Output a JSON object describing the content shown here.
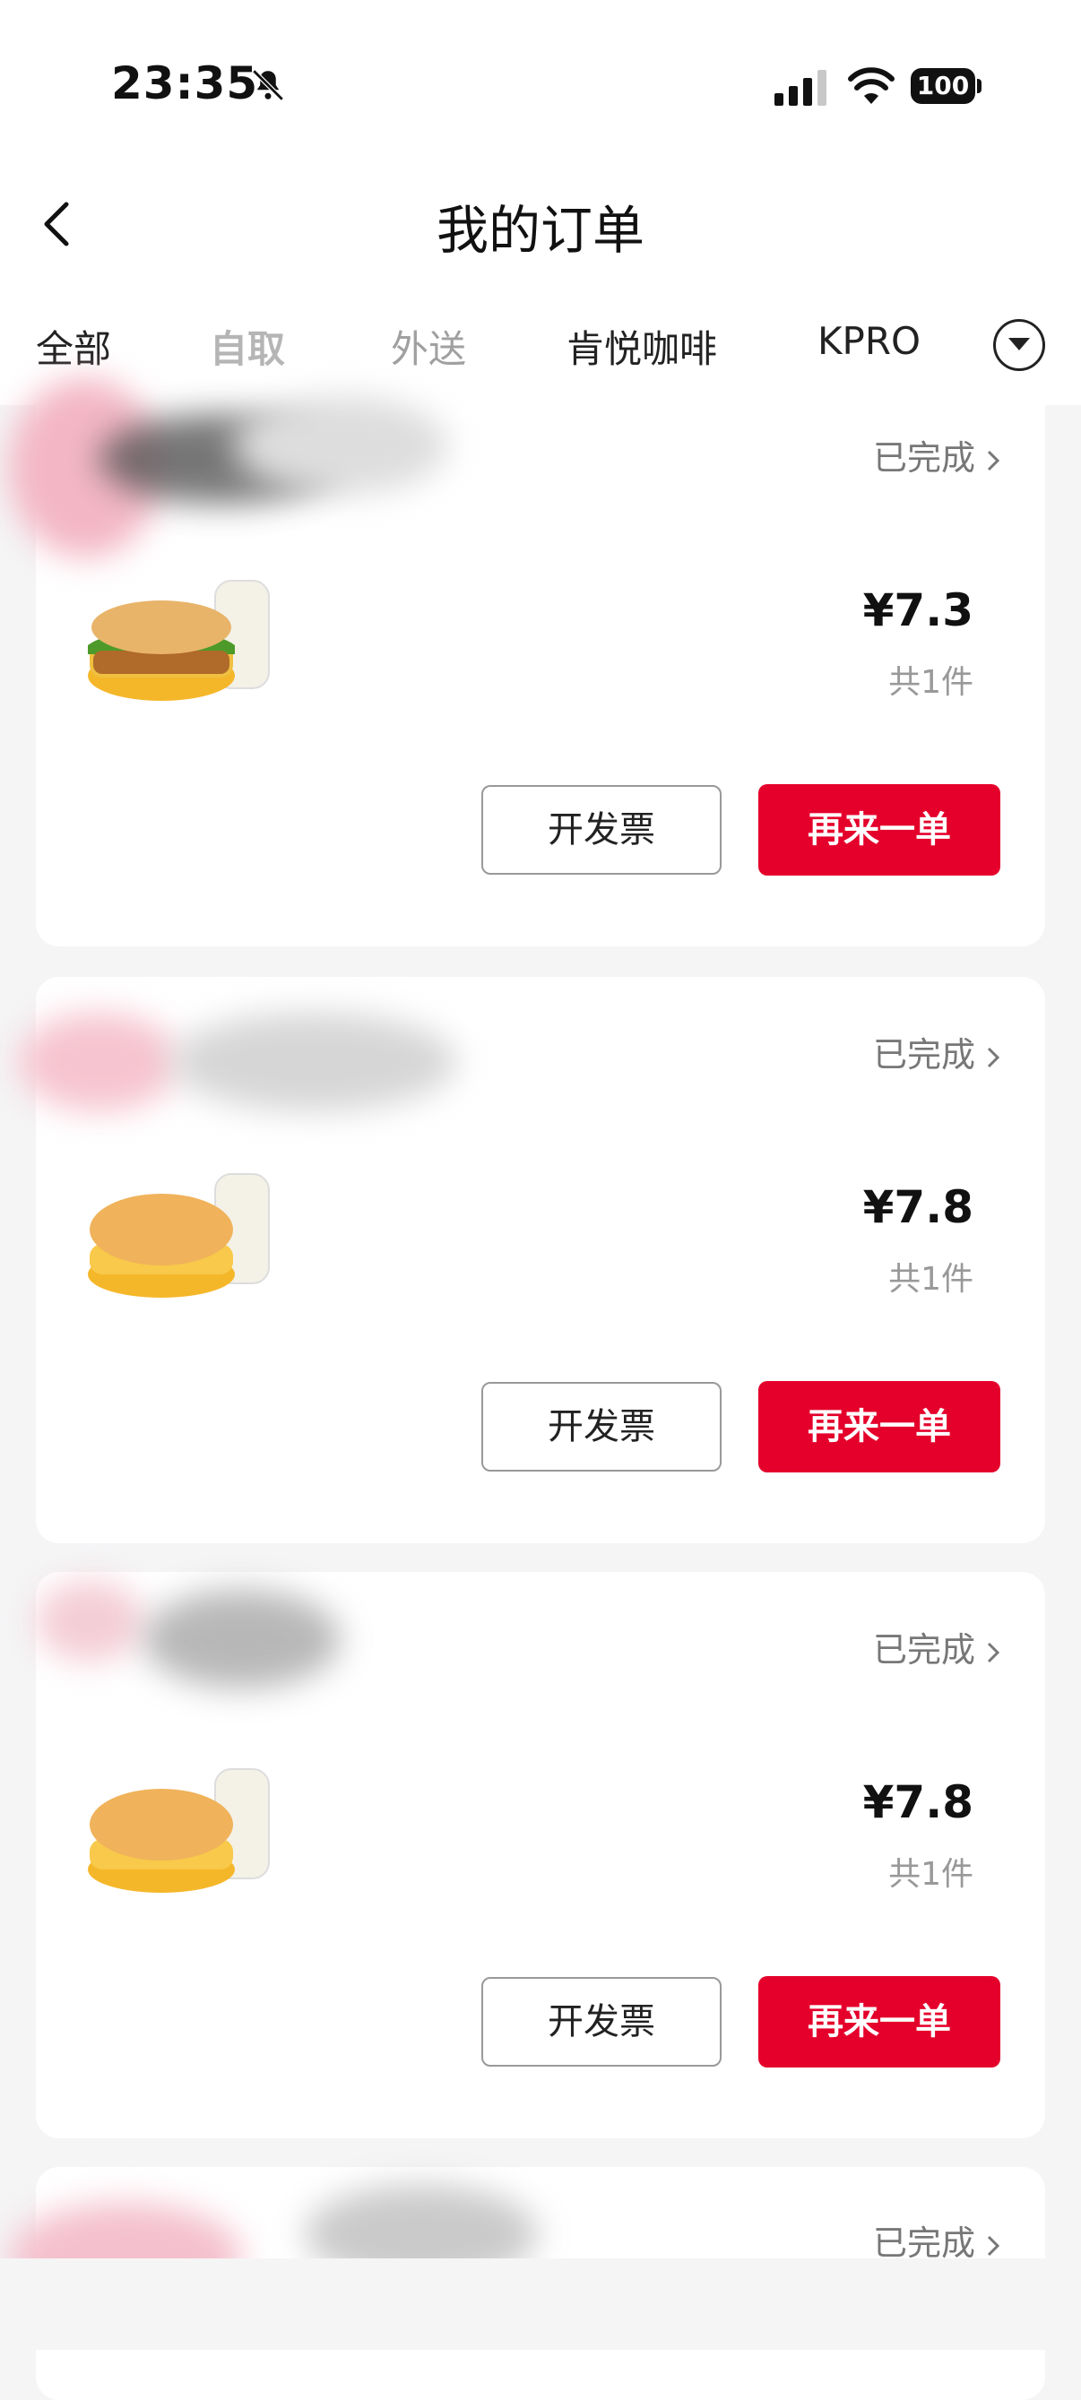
{
  "status_bar": {
    "time": "23:35",
    "battery": "100"
  },
  "header": {
    "title": "我的订单"
  },
  "tabs": [
    {
      "label": "全部"
    },
    {
      "label": "自取"
    },
    {
      "label": "外送"
    },
    {
      "label": "肯悦咖啡"
    },
    {
      "label": "KPRO"
    }
  ],
  "orders": [
    {
      "status": "已完成",
      "price": "¥7.3",
      "quantity": "共1件",
      "invoice_label": "开发票",
      "reorder_label": "再来一单"
    },
    {
      "status": "已完成",
      "price": "¥7.8",
      "quantity": "共1件",
      "invoice_label": "开发票",
      "reorder_label": "再来一单"
    },
    {
      "status": "已完成",
      "price": "¥7.8",
      "quantity": "共1件",
      "invoice_label": "开发票",
      "reorder_label": "再来一单"
    },
    {
      "status": "已完成"
    }
  ],
  "colors": {
    "accent": "#e4002b",
    "background": "#f5f5f6"
  },
  "icons": [
    "bell-slash-icon",
    "signal-icon",
    "wifi-icon",
    "battery-icon",
    "back-icon",
    "chevron-down-circle-icon",
    "chevron-right-icon"
  ]
}
